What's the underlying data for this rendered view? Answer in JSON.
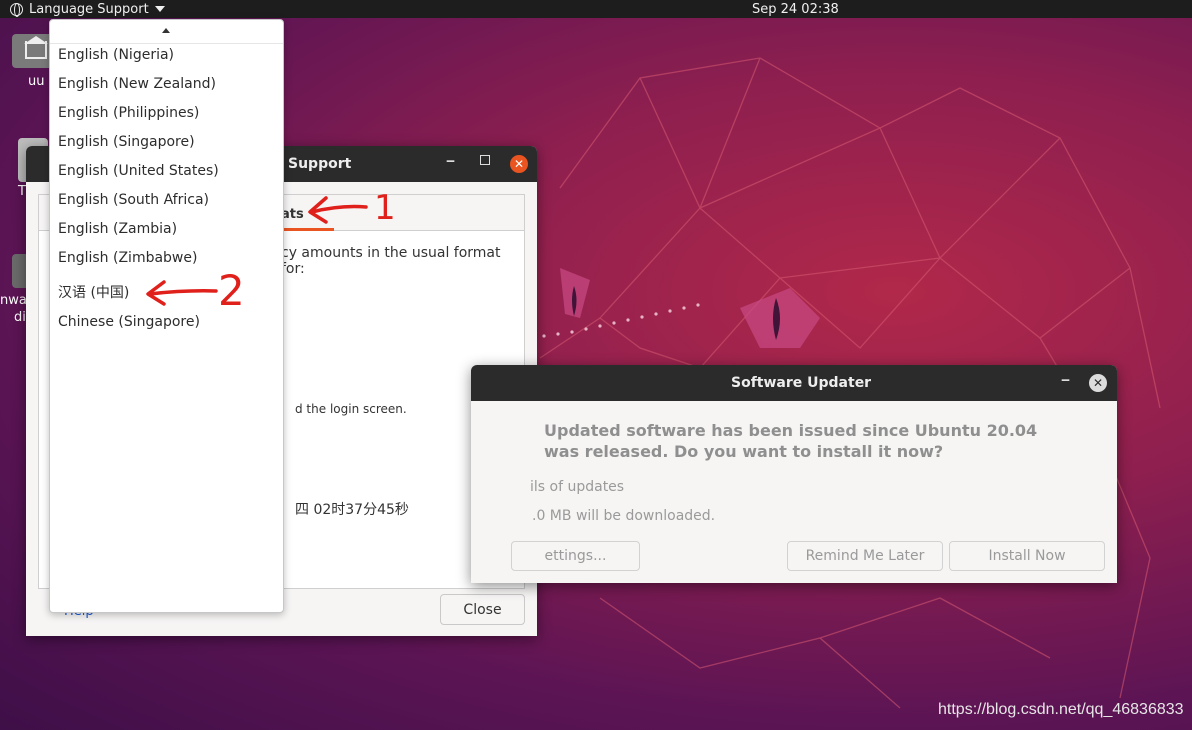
{
  "topbar": {
    "app_menu": "Language Support",
    "clock": "Sep 24  02:38"
  },
  "desktop": {
    "icons": [
      {
        "label": "uu"
      },
      {
        "label": "T"
      },
      {
        "label": "nwa"
      },
      {
        "label": "di"
      }
    ]
  },
  "language_window": {
    "title": "Support",
    "active_tab": "ats",
    "panel_text_1": "cy amounts in the usual format for:",
    "panel_text_2": "d the login screen.",
    "panel_text_3": "四 02时37分45秒",
    "help_link": "Help",
    "close_button": "Close"
  },
  "dropdown": {
    "items": [
      "English (Nigeria)",
      "English (New Zealand)",
      "English (Philippines)",
      "English (Singapore)",
      "English (United States)",
      "English (South Africa)",
      "English (Zambia)",
      "English (Zimbabwe)",
      "汉语 (中国)",
      "Chinese (Singapore)"
    ]
  },
  "updater": {
    "title": "Software Updater",
    "heading": "Updated software has been issued since Ubuntu 20.04 was released. Do you want to install it now?",
    "details": "ils of updates",
    "download": ".0 MB will be downloaded.",
    "settings_button": "ettings...",
    "remind_button": "Remind Me Later",
    "install_button": "Install Now"
  },
  "annotations": {
    "arrow1_label": "1",
    "arrow2_label": "2",
    "color": "#e0201b"
  },
  "watermark": "https://blog.csdn.net/qq_46836833"
}
